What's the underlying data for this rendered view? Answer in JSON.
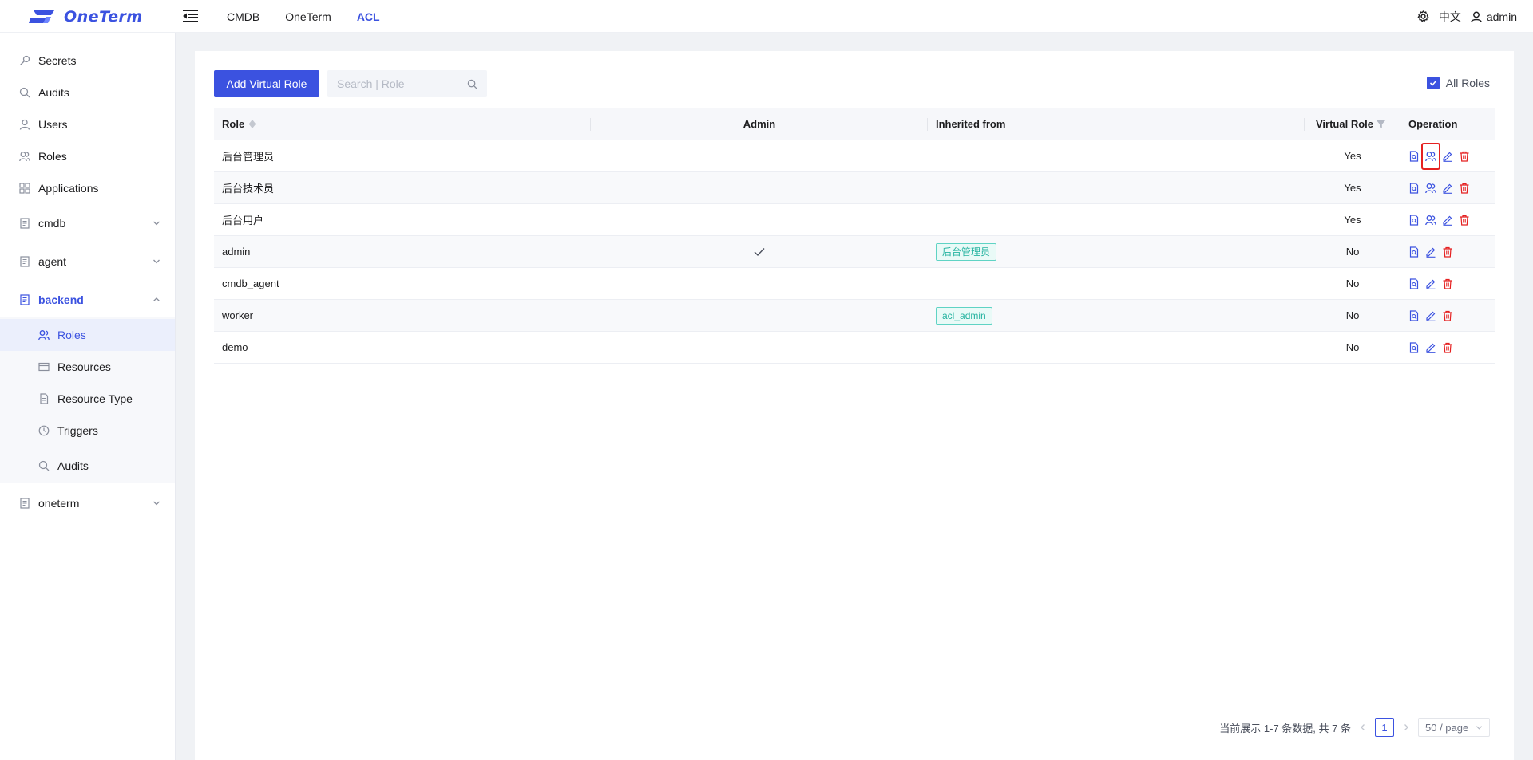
{
  "header": {
    "logo_text": "OneTerm",
    "nav": [
      {
        "label": "CMDB",
        "active": false
      },
      {
        "label": "OneTerm",
        "active": false
      },
      {
        "label": "ACL",
        "active": true
      }
    ],
    "language": "中文",
    "user": "admin"
  },
  "sidebar": {
    "items": [
      {
        "label": "Secrets",
        "icon": "key-icon"
      },
      {
        "label": "Audits",
        "icon": "search-icon"
      },
      {
        "label": "Users",
        "icon": "user-icon"
      },
      {
        "label": "Roles",
        "icon": "roles-icon"
      },
      {
        "label": "Applications",
        "icon": "apps-icon"
      }
    ],
    "groups": [
      {
        "label": "cmdb",
        "expanded": false
      },
      {
        "label": "agent",
        "expanded": false
      },
      {
        "label": "backend",
        "expanded": true
      },
      {
        "label": "oneterm",
        "expanded": false
      }
    ],
    "backend_children": [
      {
        "label": "Roles",
        "icon": "roles-icon",
        "selected": true
      },
      {
        "label": "Resources",
        "icon": "card-icon"
      },
      {
        "label": "Resource Type",
        "icon": "document-icon"
      },
      {
        "label": "Triggers",
        "icon": "clock-icon"
      },
      {
        "label": "Audits",
        "icon": "search-icon"
      }
    ]
  },
  "toolbar": {
    "add_label": "Add Virtual Role",
    "search_placeholder": "Search | Role",
    "all_roles_label": "All Roles",
    "all_roles_checked": true
  },
  "table": {
    "columns": {
      "role": "Role",
      "admin": "Admin",
      "inherited": "Inherited from",
      "virtual": "Virtual Role",
      "operation": "Operation"
    },
    "rows": [
      {
        "role": "后台管理员",
        "admin": false,
        "inherited": "",
        "virtual": "Yes"
      },
      {
        "role": "后台技术员",
        "admin": false,
        "inherited": "",
        "virtual": "Yes"
      },
      {
        "role": "后台用户",
        "admin": false,
        "inherited": "",
        "virtual": "Yes"
      },
      {
        "role": "admin",
        "admin": true,
        "inherited": "后台管理员",
        "virtual": "No"
      },
      {
        "role": "cmdb_agent",
        "admin": false,
        "inherited": "",
        "virtual": "No"
      },
      {
        "role": "worker",
        "admin": false,
        "inherited": "acl_admin",
        "virtual": "No"
      },
      {
        "role": "demo",
        "admin": false,
        "inherited": "",
        "virtual": "No"
      }
    ]
  },
  "pagination": {
    "summary": "当前展示 1-7 条数据, 共 7 条",
    "current_page": "1",
    "page_size": "50 / page"
  },
  "colors": {
    "accent": "#3b52e0",
    "tag_text": "#25b3a0",
    "danger": "#e52121"
  }
}
